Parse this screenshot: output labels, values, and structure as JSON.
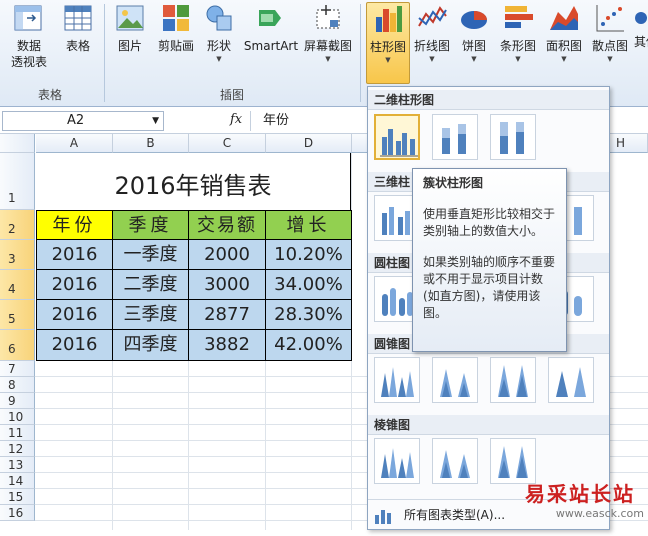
{
  "ribbon": {
    "buttons": [
      {
        "label": "数据",
        "sub": "透视表"
      },
      {
        "label": "表格"
      },
      {
        "label": "图片"
      },
      {
        "label": "剪贴画"
      },
      {
        "label": "形状"
      },
      {
        "label": "SmartArt"
      },
      {
        "label": "屏幕截图"
      },
      {
        "label": "柱形图"
      },
      {
        "label": "折线图"
      },
      {
        "label": "饼图"
      },
      {
        "label": "条形图"
      },
      {
        "label": "面积图"
      },
      {
        "label": "散点图"
      },
      {
        "label": "其他"
      }
    ],
    "groups": {
      "table": "表格",
      "illustration": "插图"
    }
  },
  "formula_bar": {
    "name_box": "A2",
    "fx": "fx",
    "value": "年份"
  },
  "columns": [
    "A",
    "B",
    "C",
    "D",
    "H"
  ],
  "rows": [
    "1",
    "2",
    "3",
    "4",
    "5",
    "6",
    "7",
    "8",
    "9",
    "10",
    "11",
    "12",
    "13",
    "14",
    "15",
    "16"
  ],
  "sheet": {
    "title": "2016年销售表",
    "headers": [
      "年份",
      "季度",
      "交易额",
      "增长"
    ],
    "data": [
      [
        "2016",
        "一季度",
        "2000",
        "10.20%"
      ],
      [
        "2016",
        "二季度",
        "3000",
        "34.00%"
      ],
      [
        "2016",
        "三季度",
        "2877",
        "28.30%"
      ],
      [
        "2016",
        "四季度",
        "3882",
        "42.00%"
      ]
    ]
  },
  "gallery": {
    "sections": [
      "二维柱形图",
      "三维柱",
      "圆柱图",
      "圆锥图",
      "棱锥图"
    ],
    "all_charts": "所有图表类型(A)..."
  },
  "tooltip": {
    "title": "簇状柱形图",
    "p1": "使用垂直矩形比较相交于类别轴上的数值大小。",
    "p2": "如果类别轴的顺序不重要或不用于显示项目计数(如直方图)，请使用该图。"
  },
  "watermark": {
    "text": "易采站长站",
    "url": "www.easck.com"
  },
  "colors": {
    "header_yellow": "#ffff00",
    "header_green": "#92d050",
    "data_blue": "#bdd7ee",
    "accent": "#f8c64a"
  }
}
